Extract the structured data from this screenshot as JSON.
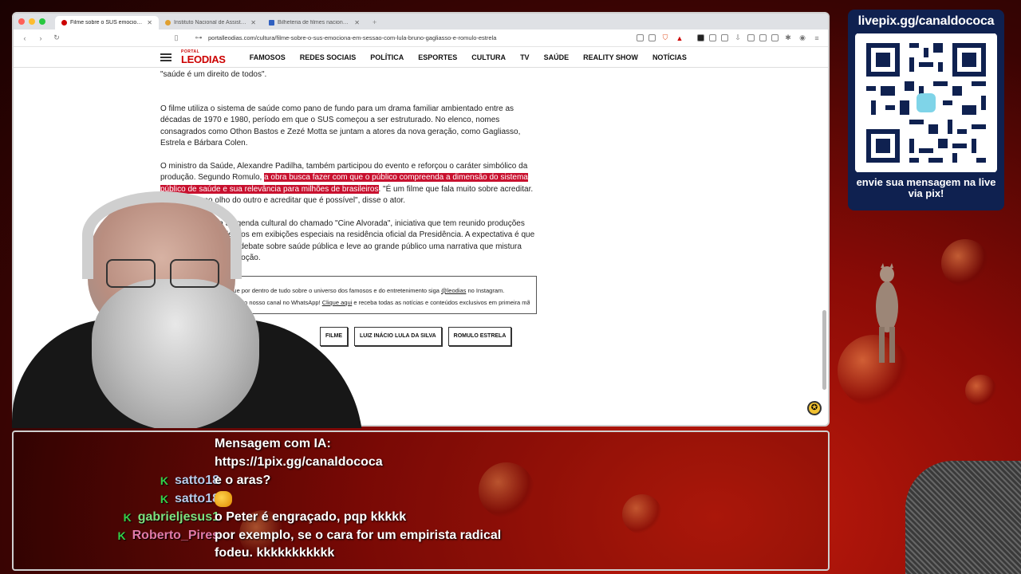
{
  "browser": {
    "tabs": [
      {
        "title": "Filme sobre o SUS emociona e...",
        "active": true
      },
      {
        "title": "Instituto Nacional de Assistência...",
        "active": false
      },
      {
        "title": "Bilheteria de filmes nacionais nos...",
        "active": false
      }
    ],
    "url": "portalleodias.com/cultura/filme-sobre-o-sus-emociona-em-sessao-com-lula-bruno-gagliasso-e-romulo-estrela"
  },
  "site": {
    "logo_small": "PORTAL",
    "logo_big": "LEODIAS",
    "nav": [
      "FAMOSOS",
      "REDES SOCIAIS",
      "POLÍTICA",
      "ESPORTES",
      "CULTURA",
      "TV",
      "SAÚDE",
      "REALITY SHOW",
      "NOTÍCIAS"
    ]
  },
  "article": {
    "p0": "\"saúde é um direito de todos\".",
    "p1": "O filme utiliza o sistema de saúde como pano de fundo para um drama familiar ambientado entre as décadas de 1970 e 1980, período em que o SUS começou a ser estruturado. No elenco, nomes consagrados como Othon Bastos e Zezé Motta se juntam a atores da nova geração, como Gagliasso, Estrela e Bárbara Colen.",
    "p2_a": "O ministro da Saúde, Alexandre Padilha, também participou do evento e reforçou o caráter simbólico da produção. Segundo Romulo, ",
    "p2_hl": "a obra busca fazer com que o público compreenda a dimensão do sistema público de saúde e sua relevância para milhões de brasileiros",
    "p2_b": ". \"É um filme que fala muito sobre acreditar. Sobre olhar no olho do outro e acreditar que é possível\", disse o ator.",
    "p3": "A exibição integra a agenda cultural do chamado \"Cine Alvorada\", iniciativa que tem reunido produções nacionais e seus elencos em exibições especiais na residência oficial da Presidência. A expectativa é que \"Por um Fio\" amplie o debate sobre saúde pública e leve ao grande público uma narrativa que mistura memória, política e emoção.",
    "cta_line1_a": "Fique por dentro de tudo sobre o universo dos famosos e do entretenimento siga ",
    "cta_handle": "@leodias",
    "cta_line1_b": " no Instagram.",
    "cta_line2_a": "Entre no nosso canal no WhatsApp! ",
    "cta_link": "Clique aqui",
    "cta_line2_b": " e receba todas as notícias e conteúdos exclusivos em primeira mão.",
    "tags": [
      "FILME",
      "LUIZ INÁCIO LULA DA SILVA",
      "ROMULO ESTRELA"
    ]
  },
  "pix": {
    "title": "livepix.gg/canaldococa",
    "footer": "envie sua mensagem na live via pix!"
  },
  "chat": [
    {
      "user": "",
      "color": "#ffffff",
      "badge": false,
      "msg": "Mensagem com IA:"
    },
    {
      "user": "",
      "color": "#ffffff",
      "badge": false,
      "msg": "https://1pix.gg/canaldococa"
    },
    {
      "user": "satto18",
      "color": "#b9c9e8",
      "badge": true,
      "msg": "e o aras?"
    },
    {
      "user": "satto18",
      "color": "#b9c9e8",
      "badge": true,
      "msg": "",
      "emote": true
    },
    {
      "user": "gabrieljesus1",
      "color": "#7ee07e",
      "badge": true,
      "msg": "o Peter é engraçado, pqp kkkkk"
    },
    {
      "user": "Roberto_Pires",
      "color": "#e07aa8",
      "badge": true,
      "msg": "por exemplo, se o cara for um empirista radical"
    },
    {
      "user": "",
      "color": "#ffffff",
      "badge": false,
      "msg": "fodeu. kkkkkkkkkkk"
    }
  ],
  "colors": {
    "accent": "#c8102e",
    "pix_bg": "#0f2150",
    "chat_badge": "#35d04a"
  }
}
